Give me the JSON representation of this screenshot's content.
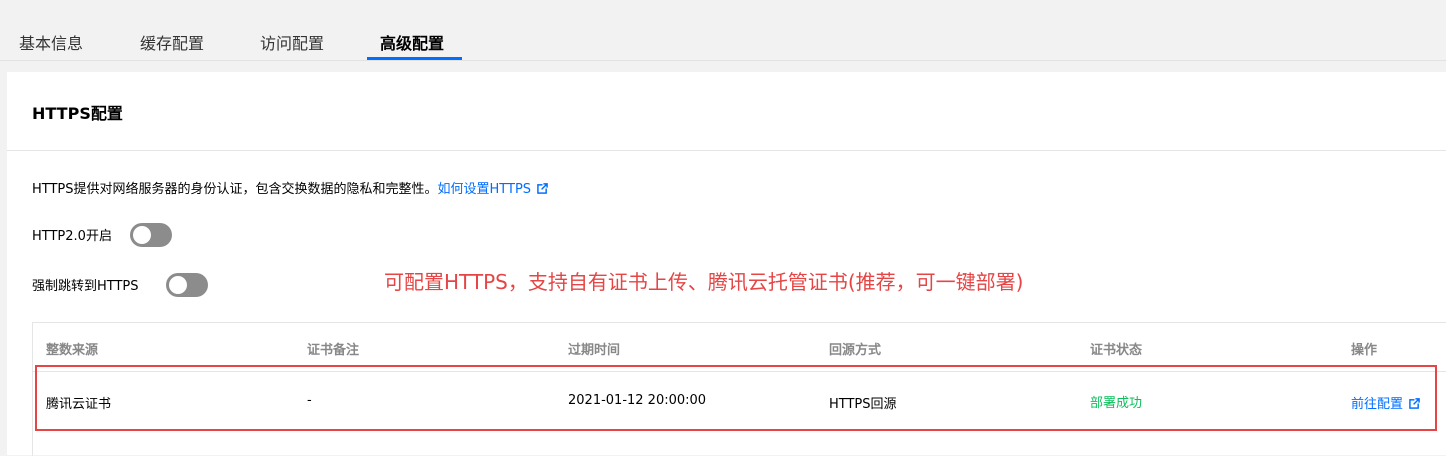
{
  "tabs": [
    {
      "label": "基本信息",
      "active": false
    },
    {
      "label": "缓存配置",
      "active": false
    },
    {
      "label": "访问配置",
      "active": false
    },
    {
      "label": "高级配置",
      "active": true
    }
  ],
  "panel": {
    "title": "HTTPS配置",
    "description": "HTTPS提供对网络服务器的身份认证，包含交换数据的隐私和完整性。",
    "help_link": "如何设置HTTPS",
    "http2_label": "HTTP2.0开启",
    "http2_enabled": false,
    "force_https_label": "强制跳转到HTTPS",
    "force_https_enabled": false
  },
  "annotation": "可配置HTTPS，支持自有证书上传、腾讯云托管证书(推荐，可一键部署)",
  "table": {
    "columns": [
      "整数来源",
      "证书备注",
      "过期时间",
      "回源方式",
      "证书状态",
      "操作"
    ],
    "rows": [
      {
        "source": "腾讯云证书",
        "remark": "-",
        "expire": "2021-01-12 20:00:00",
        "origin": "HTTPS回源",
        "status": "部署成功",
        "action": "前往配置"
      }
    ]
  },
  "colors": {
    "accent": "#006eff",
    "success": "#0abf5b",
    "annotation": "#e54545",
    "toggle_off": "#8c8c8c"
  }
}
